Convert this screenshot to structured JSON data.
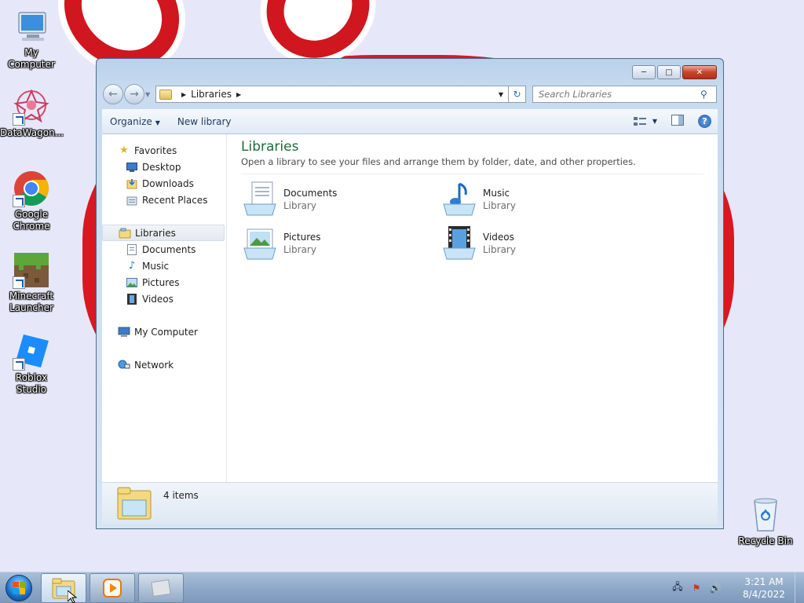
{
  "desktop": {
    "icons": [
      {
        "label": "My Computer",
        "icon": "my-computer-icon"
      },
      {
        "label": "DataWagon...",
        "icon": "datawagon-icon"
      },
      {
        "label": "Google Chrome",
        "icon": "chrome-icon"
      },
      {
        "label": "Minecraft Launcher",
        "icon": "minecraft-icon"
      },
      {
        "label": "Roblox Studio",
        "icon": "roblox-studio-icon"
      },
      {
        "label": "Recycle Bin",
        "icon": "recycle-bin-icon"
      }
    ]
  },
  "window": {
    "address": {
      "crumb": "Libraries"
    },
    "search": {
      "placeholder": "Search Libraries"
    },
    "toolbar": {
      "organize": "Organize",
      "new_library": "New library"
    },
    "navpane": {
      "favorites": "Favorites",
      "desktop": "Desktop",
      "downloads": "Downloads",
      "recent_places": "Recent Places",
      "libraries": "Libraries",
      "documents": "Documents",
      "music": "Music",
      "pictures": "Pictures",
      "videos": "Videos",
      "my_computer": "My Computer",
      "network": "Network"
    },
    "content": {
      "title": "Libraries",
      "subtitle": "Open a library to see your files and arrange them by folder, date, and other properties.",
      "libraries": [
        {
          "name": "Documents",
          "kind": "Library",
          "icon": "documents-library-icon"
        },
        {
          "name": "Music",
          "kind": "Library",
          "icon": "music-library-icon"
        },
        {
          "name": "Pictures",
          "kind": "Library",
          "icon": "pictures-library-icon"
        },
        {
          "name": "Videos",
          "kind": "Library",
          "icon": "videos-library-icon"
        }
      ]
    },
    "status": {
      "count": "4 items"
    }
  },
  "taskbar": {
    "clock": {
      "time": "3:21 AM",
      "date": "8/4/2022"
    }
  },
  "colors": {
    "accent_title": "#1e6a3b",
    "taskbar": "#8fa9c8",
    "wallpaper_red": "#d91821"
  }
}
